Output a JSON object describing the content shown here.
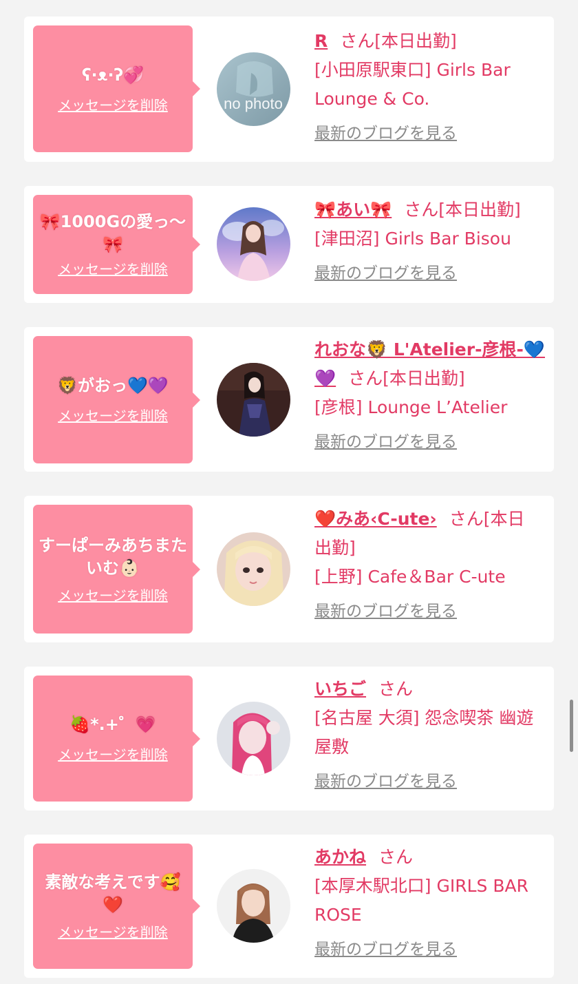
{
  "delete_label": "メッセージを削除",
  "blog_label": "最新のブログを見る",
  "san_suffix": "さん",
  "colors": {
    "background": "#f3f3f3",
    "bubble": "#fd8ea2",
    "accent": "#e23a64",
    "link_gray": "#8a8a8a"
  },
  "cards": [
    {
      "message": "ʕ·ᴥ·ʔ💞",
      "name": "R",
      "status": "[本日出勤]",
      "shop": "[小田原駅東口] Girls Bar Lounge & Co.",
      "avatar_text": "no photo",
      "avatar": "no-photo-placeholder"
    },
    {
      "message": "🎀1000Gの愛っ〜🎀",
      "name": "🎀あい🎀",
      "status": "[本日出勤]",
      "shop": "[津田沼] Girls Bar Bisou",
      "avatar": "profile-photo"
    },
    {
      "message": "🦁がおっ💙💜",
      "name": "れおな🦁 L'Atelier-彦根-💙💜",
      "status": "[本日出勤]",
      "shop": "[彦根] Lounge L’Atelier",
      "avatar": "profile-photo"
    },
    {
      "message": "すーぱーみあちまたいむ👶🏻",
      "name": "❤️みあ‹C-ute›",
      "status": "[本日出勤]",
      "shop": "[上野] Cafe＆Bar C-ute",
      "avatar": "profile-photo"
    },
    {
      "message": "🍓*.+゜💗",
      "name": "いちご",
      "status": "",
      "shop": "[名古屋 大須] 怨念喫茶 幽遊屋敷",
      "avatar": "profile-photo"
    },
    {
      "message": "素敵な考えです🥰❤️",
      "name": "あかね",
      "status": "",
      "shop": "[本厚木駅北口] GIRLS BAR ROSE",
      "avatar": "profile-photo"
    }
  ]
}
